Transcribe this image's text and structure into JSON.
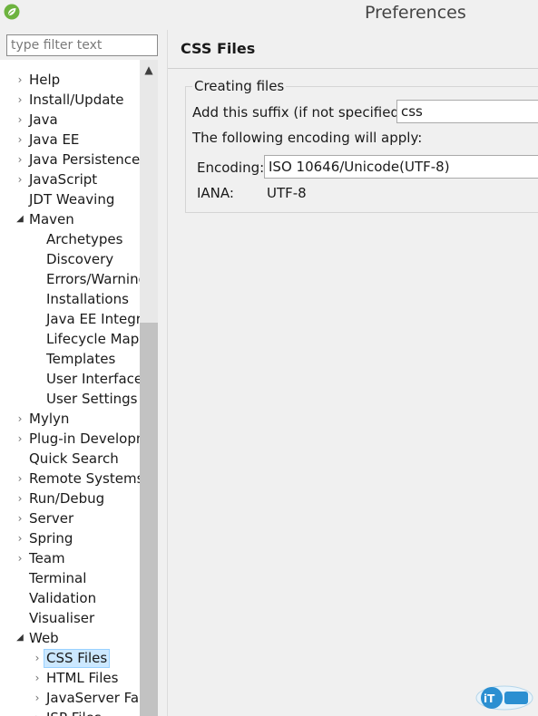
{
  "window": {
    "title": "Preferences"
  },
  "filter": {
    "placeholder": "type filter text"
  },
  "tree": [
    {
      "label": "Help",
      "depth": 0,
      "twisty": "collapsed"
    },
    {
      "label": "Install/Update",
      "depth": 0,
      "twisty": "collapsed"
    },
    {
      "label": "Java",
      "depth": 0,
      "twisty": "collapsed"
    },
    {
      "label": "Java EE",
      "depth": 0,
      "twisty": "collapsed"
    },
    {
      "label": "Java Persistence",
      "depth": 0,
      "twisty": "collapsed"
    },
    {
      "label": "JavaScript",
      "depth": 0,
      "twisty": "collapsed"
    },
    {
      "label": "JDT Weaving",
      "depth": 0,
      "twisty": "none"
    },
    {
      "label": "Maven",
      "depth": 0,
      "twisty": "expanded"
    },
    {
      "label": "Archetypes",
      "depth": 1,
      "twisty": "none"
    },
    {
      "label": "Discovery",
      "depth": 1,
      "twisty": "none"
    },
    {
      "label": "Errors/Warnings",
      "depth": 1,
      "twisty": "none"
    },
    {
      "label": "Installations",
      "depth": 1,
      "twisty": "none"
    },
    {
      "label": "Java EE Integration",
      "depth": 1,
      "twisty": "none"
    },
    {
      "label": "Lifecycle Mappings",
      "depth": 1,
      "twisty": "none"
    },
    {
      "label": "Templates",
      "depth": 1,
      "twisty": "none"
    },
    {
      "label": "User Interface",
      "depth": 1,
      "twisty": "none"
    },
    {
      "label": "User Settings",
      "depth": 1,
      "twisty": "none"
    },
    {
      "label": "Mylyn",
      "depth": 0,
      "twisty": "collapsed"
    },
    {
      "label": "Plug-in Development",
      "depth": 0,
      "twisty": "collapsed"
    },
    {
      "label": "Quick Search",
      "depth": 0,
      "twisty": "none"
    },
    {
      "label": "Remote Systems",
      "depth": 0,
      "twisty": "collapsed"
    },
    {
      "label": "Run/Debug",
      "depth": 0,
      "twisty": "collapsed"
    },
    {
      "label": "Server",
      "depth": 0,
      "twisty": "collapsed"
    },
    {
      "label": "Spring",
      "depth": 0,
      "twisty": "collapsed"
    },
    {
      "label": "Team",
      "depth": 0,
      "twisty": "collapsed"
    },
    {
      "label": "Terminal",
      "depth": 0,
      "twisty": "none"
    },
    {
      "label": "Validation",
      "depth": 0,
      "twisty": "none"
    },
    {
      "label": "Visualiser",
      "depth": 0,
      "twisty": "none"
    },
    {
      "label": "Web",
      "depth": 0,
      "twisty": "expanded"
    },
    {
      "label": "CSS Files",
      "depth": 1,
      "twisty": "collapsed",
      "selected": true
    },
    {
      "label": "HTML Files",
      "depth": 1,
      "twisty": "collapsed"
    },
    {
      "label": "JavaServer Faces Tools",
      "depth": 1,
      "twisty": "collapsed"
    },
    {
      "label": "JSP Files",
      "depth": 1,
      "twisty": "collapsed"
    }
  ],
  "page": {
    "title": "CSS Files",
    "group_label": "Creating files",
    "suffix_label": "Add this suffix (if not specified):",
    "suffix_value": "css",
    "encoding_note": "The following encoding will apply:",
    "encoding_label": "Encoding:",
    "encoding_value": "ISO 10646/Unicode(UTF-8)",
    "iana_label": "IANA:",
    "iana_value": "UTF-8"
  },
  "colors": {
    "selection": "#cce8ff",
    "spring_green": "#6db33f"
  },
  "icons": {
    "app": "spring-leaf-icon",
    "watermark": "ithome-logo"
  }
}
